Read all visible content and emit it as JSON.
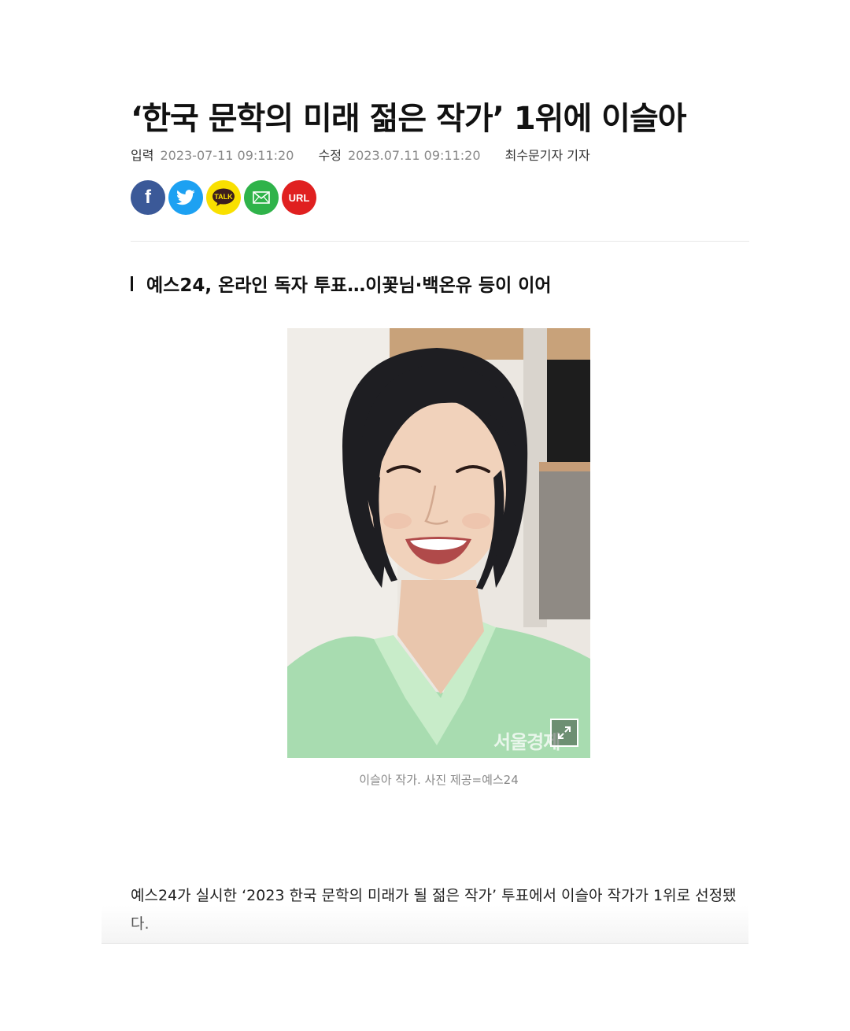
{
  "article": {
    "headline": "‘한국 문학의 미래 젊은 작가’ 1위에 이슬아",
    "meta": {
      "input_label": "입력",
      "input_time": "2023-07-11 09:11:20",
      "modified_label": "수정",
      "modified_time": "2023.07.11 09:11:20",
      "reporter": "최수문기자 기자"
    },
    "share": {
      "facebook_icon": "f",
      "kakao_label": "TALK",
      "url_label": "URL"
    },
    "subheadline": "예스24, 온라인 독자 투표…이꽃님·백온유 등이 이어",
    "photo": {
      "watermark": "서울경제",
      "caption": "이슬아 작가. 사진 제공=예스24"
    },
    "body": "예스24가 실시한 ‘2023 한국 문학의 미래가 될 젊은 작가’ 투표에서 이슬아 작가가 1위로 선정됐다."
  },
  "colors": {
    "facebook": "#3b5998",
    "twitter": "#1da1f2",
    "kakao": "#f9e000",
    "mail": "#2fb34a",
    "url": "#e02020"
  }
}
